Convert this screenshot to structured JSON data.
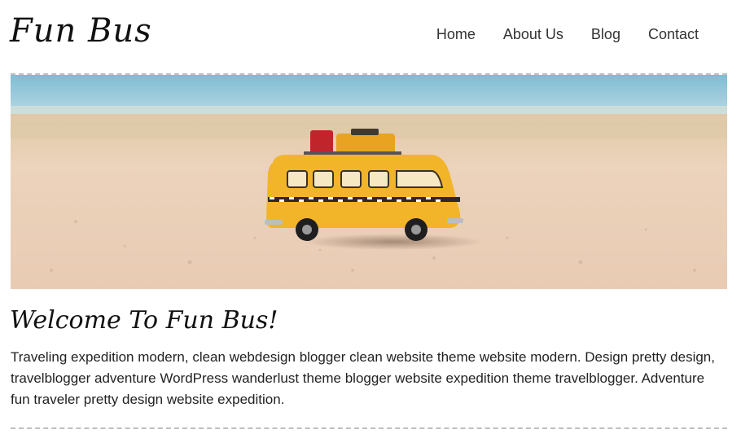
{
  "header": {
    "logo": "Fun Bus",
    "nav": [
      {
        "label": "Home"
      },
      {
        "label": "About Us"
      },
      {
        "label": "Blog"
      },
      {
        "label": "Contact"
      }
    ]
  },
  "hero": {
    "image_subject": "yellow toy bus on sandy beach"
  },
  "main": {
    "heading": "Welcome To Fun Bus!",
    "paragraph": "Traveling expedition modern, clean webdesign blogger clean website theme website modern. Design pretty design, travelblogger adventure WordPress wanderlust theme blogger website expedition theme travelblogger. Adventure fun traveler pretty design website expedition."
  },
  "colors": {
    "sky": "#8cc3d6",
    "sand": "#e9cdb3",
    "bus": "#f2b428",
    "divider": "#bfbfbf"
  }
}
